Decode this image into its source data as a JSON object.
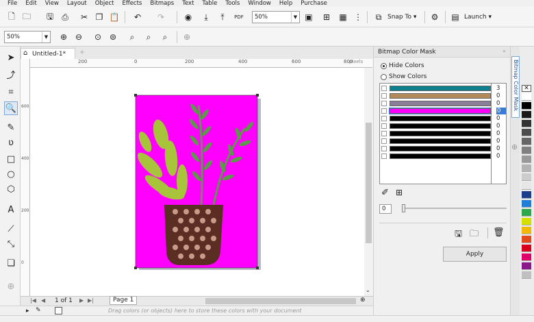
{
  "menu": [
    "File",
    "Edit",
    "View",
    "Layout",
    "Object",
    "Effects",
    "Bitmaps",
    "Text",
    "Table",
    "Tools",
    "Window",
    "Help",
    "Purchase"
  ],
  "toolbar": {
    "zoom_value": "50%",
    "snap_label": "Snap To",
    "launch_label": "Launch"
  },
  "property_bar": {
    "zoom_value": "50%"
  },
  "document": {
    "tab_title": "Untitled-1*",
    "ruler_labels": [
      "200",
      "0",
      "200",
      "400",
      "600",
      "800"
    ],
    "ruler_unit": "pixels",
    "v_ruler_labels": [
      "600",
      "400",
      "200",
      "0"
    ]
  },
  "page_nav": {
    "page_of": "1 of 1",
    "page_tab": "Page 1"
  },
  "status": {
    "hint": "Drag colors (or objects) here to store these colors with your document"
  },
  "docker": {
    "title": "Bitmap Color Mask",
    "rail_label": "Bitmap Color Mask",
    "mode_hide": "Hide Colors",
    "mode_show": "Show Colors",
    "tolerance_value": "0",
    "apply_label": "Apply",
    "rows": [
      {
        "color": "#0e7f8c",
        "tolerance": "3",
        "selected": false
      },
      {
        "color": "#b38a5a",
        "tolerance": "0",
        "selected": false
      },
      {
        "color": "#8a7e98",
        "tolerance": "0",
        "selected": false
      },
      {
        "color": "#ff00ff",
        "tolerance": "0",
        "selected": true
      },
      {
        "color": "#000000",
        "tolerance": "0",
        "selected": false
      },
      {
        "color": "#000000",
        "tolerance": "0",
        "selected": false
      },
      {
        "color": "#000000",
        "tolerance": "0",
        "selected": false
      },
      {
        "color": "#000000",
        "tolerance": "0",
        "selected": false
      },
      {
        "color": "#000000",
        "tolerance": "0",
        "selected": false
      },
      {
        "color": "#000000",
        "tolerance": "0",
        "selected": false
      }
    ]
  },
  "palette": [
    "#ffffff",
    "#000000",
    "#1a1a1a",
    "#333333",
    "#4d4d4d",
    "#666666",
    "#808080",
    "#999999",
    "#b3b3b3",
    "#cccccc",
    "#e6e6e6",
    "#1a3e8c",
    "#1f7fd6",
    "#2aa84a",
    "#d6e000",
    "#f2b800",
    "#e24a1b",
    "#d9001b",
    "#e0006a",
    "#8a1a8c",
    "#c0c0c0"
  ],
  "illustration": {
    "page_color": "#ff00ff",
    "leaf_color": "#a8c43a",
    "stem_color": "#5a9a48",
    "pot_color": "#5a2e22",
    "dot_color": "#c89a8a"
  }
}
